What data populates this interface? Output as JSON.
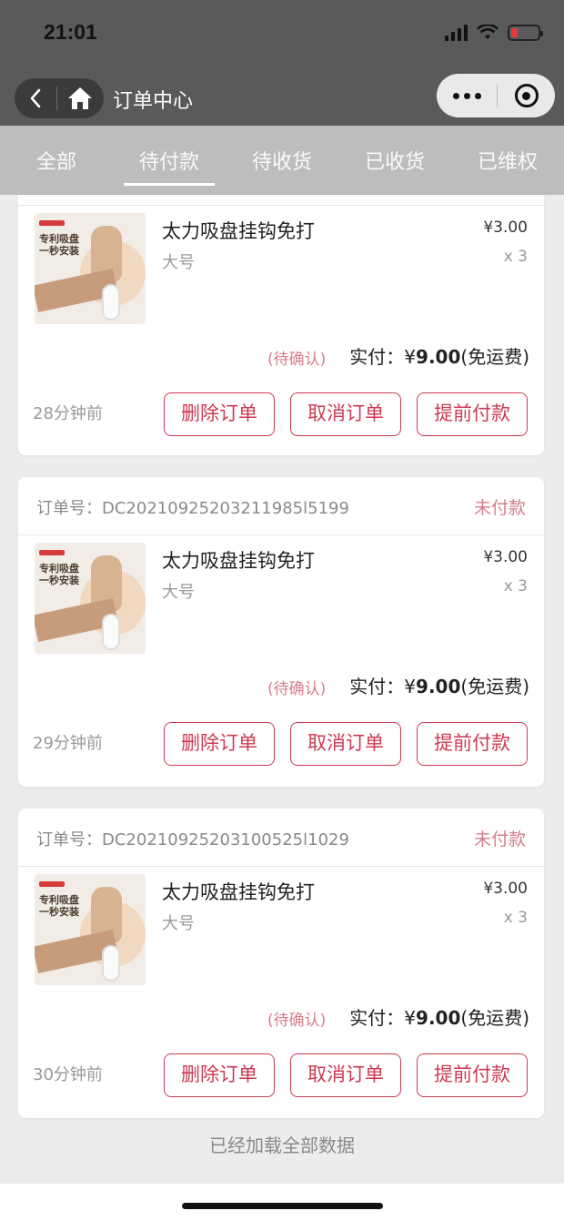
{
  "status_bar": {
    "time": "21:01"
  },
  "nav": {
    "title": "订单中心"
  },
  "tabs": [
    {
      "label": "全部"
    },
    {
      "label": "待付款",
      "active": true
    },
    {
      "label": "待收货"
    },
    {
      "label": "已收货"
    },
    {
      "label": "已维权"
    }
  ],
  "colors": {
    "accent": "#cc3a52",
    "status_unpaid": "#d77c8c",
    "tab_bar": "#bdbdbd",
    "nav_bar": "#5a5a5c"
  },
  "product_image_text": "专利吸盘一秒安装",
  "orders": [
    {
      "order_no": "",
      "status": "",
      "product": "太力吸盘挂钩免打",
      "spec": "大号",
      "price": "¥3.00",
      "qty": "x 3",
      "pending": "(待确认)",
      "paid_prefix": "实付：¥",
      "paid_amount": "9.00",
      "paid_suffix": "(免运费)",
      "time_ago": "28分钟前",
      "btn_delete": "删除订单",
      "btn_cancel": "取消订单",
      "btn_pay": "提前付款"
    },
    {
      "order_no": "订单号：DC20210925203211985l5199",
      "status": "未付款",
      "product": "太力吸盘挂钩免打",
      "spec": "大号",
      "price": "¥3.00",
      "qty": "x 3",
      "pending": "(待确认)",
      "paid_prefix": "实付：¥",
      "paid_amount": "9.00",
      "paid_suffix": "(免运费)",
      "time_ago": "29分钟前",
      "btn_delete": "删除订单",
      "btn_cancel": "取消订单",
      "btn_pay": "提前付款"
    },
    {
      "order_no": "订单号：DC20210925203100525l1029",
      "status": "未付款",
      "product": "太力吸盘挂钩免打",
      "spec": "大号",
      "price": "¥3.00",
      "qty": "x 3",
      "pending": "(待确认)",
      "paid_prefix": "实付：¥",
      "paid_amount": "9.00",
      "paid_suffix": "(免运费)",
      "time_ago": "30分钟前",
      "btn_delete": "删除订单",
      "btn_cancel": "取消订单",
      "btn_pay": "提前付款"
    }
  ],
  "footer": {
    "all_loaded": "已经加载全部数据"
  }
}
